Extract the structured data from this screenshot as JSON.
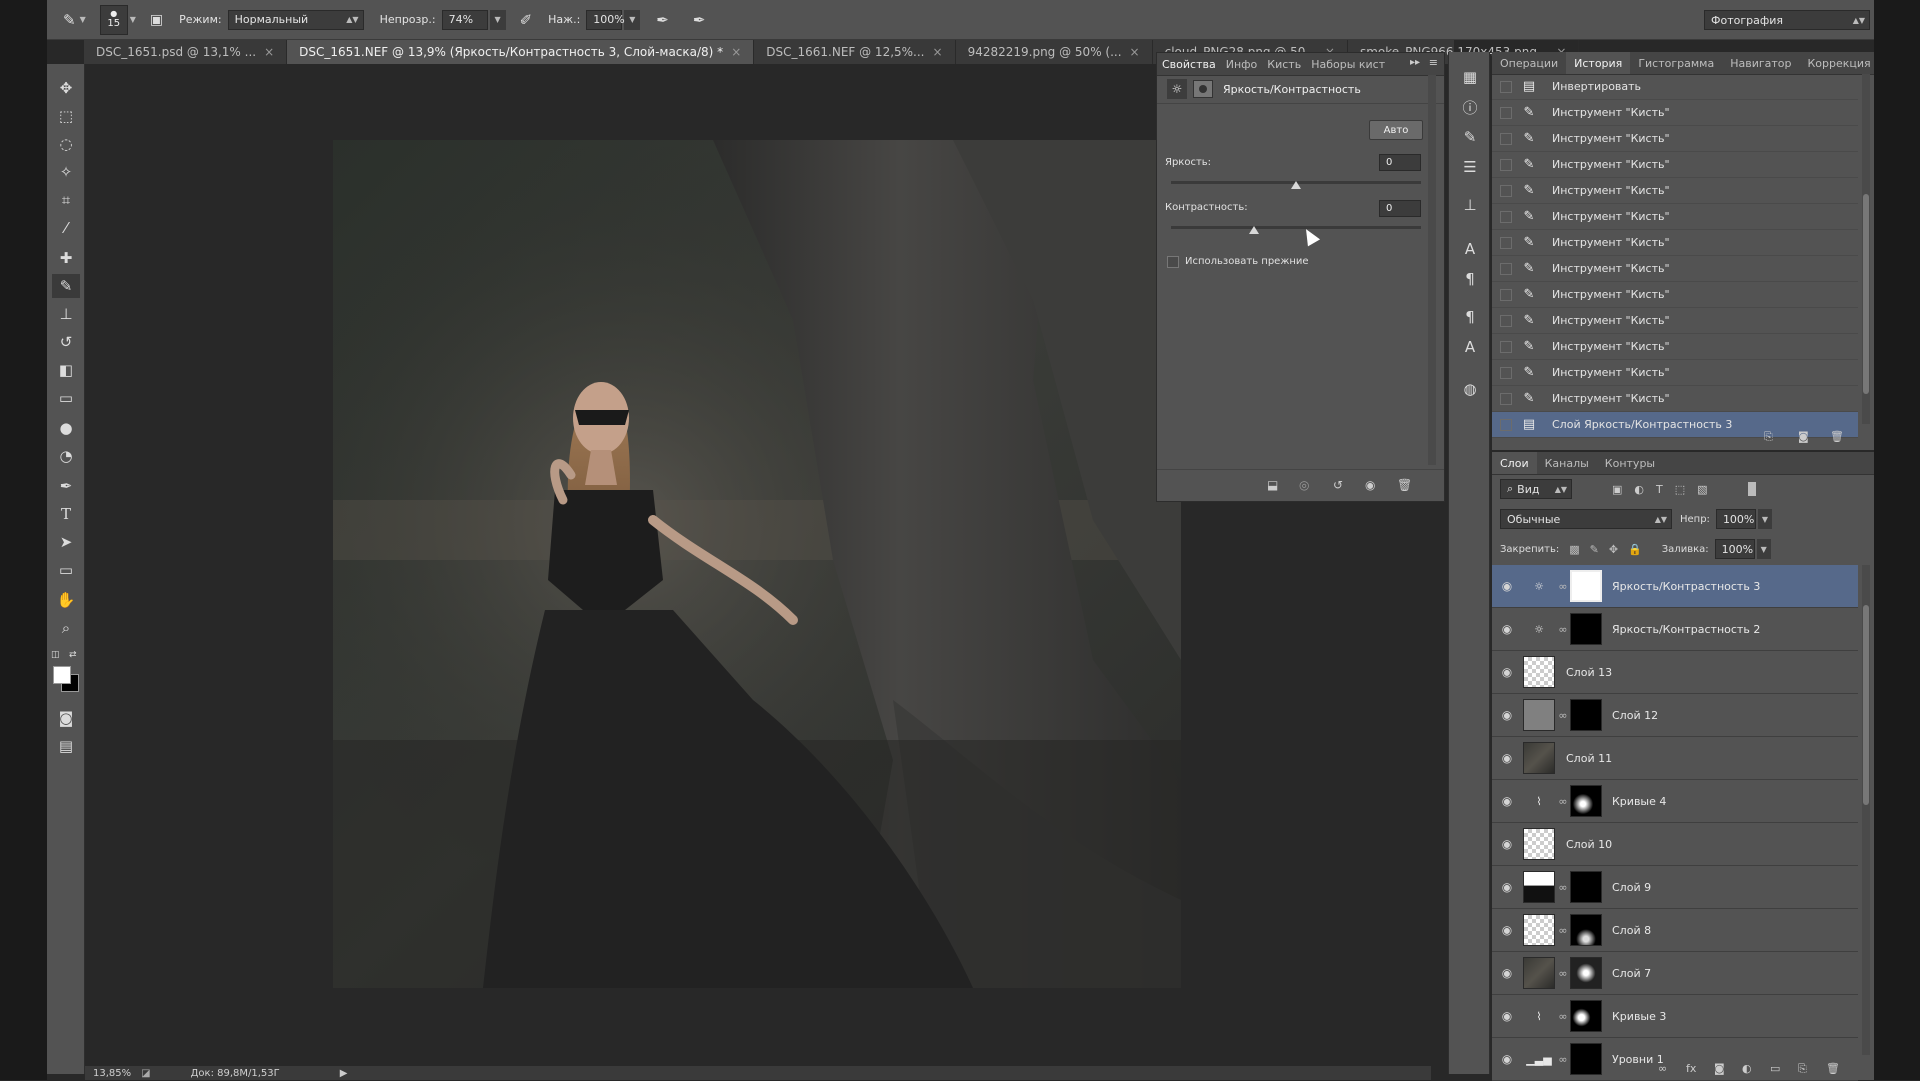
{
  "options": {
    "brush_size": "15",
    "mode_label": "Режим:",
    "mode_value": "Нормальный",
    "opacity_label": "Непрозр.:",
    "opacity_value": "74%",
    "pressure_label": "Наж.:",
    "pressure_value": "100%",
    "workspace": "Фотография"
  },
  "tabs": [
    {
      "label": "DSC_1651.psd @ 13,1% ..."
    },
    {
      "label": "DSC_1651.NEF @ 13,9% (Яркость/Контрастность 3, Слой-маска/8) *"
    },
    {
      "label": "DSC_1661.NEF @ 12,5%..."
    },
    {
      "label": "94282219.png @ 50% (..."
    },
    {
      "label": "cloud_PNG28.png @ 50..."
    },
    {
      "label": "smoke_PNG966.170x453.png..."
    }
  ],
  "properties": {
    "tabs": [
      "Свойства",
      "Инфо",
      "Кисть",
      "Наборы кист"
    ],
    "title": "Яркость/Контрастность",
    "auto": "Авто",
    "brightness_label": "Яркость:",
    "brightness_value": "0",
    "brightness_level": 0,
    "contrast_label": "Контрастность:",
    "contrast_value": "0",
    "contrast_level": 0,
    "legacy": "Использовать прежние"
  },
  "history": {
    "tabs": [
      "Операции",
      "История",
      "Гистограмма",
      "Навигатор",
      "Коррекция"
    ],
    "items": [
      "Инвертировать",
      "Инструмент \"Кисть\"",
      "Инструмент \"Кисть\"",
      "Инструмент \"Кисть\"",
      "Инструмент \"Кисть\"",
      "Инструмент \"Кисть\"",
      "Инструмент \"Кисть\"",
      "Инструмент \"Кисть\"",
      "Инструмент \"Кисть\"",
      "Инструмент \"Кисть\"",
      "Инструмент \"Кисть\"",
      "Инструмент \"Кисть\"",
      "Инструмент \"Кисть\"",
      "Слой Яркость/Контрастность 3"
    ]
  },
  "layers_panel": {
    "tabs": [
      "Слои",
      "Каналы",
      "Контуры"
    ],
    "filter": "Вид",
    "blend": "Обычные",
    "opacity_label": "Непр:",
    "opacity_value": "100%",
    "lock_label": "Закрепить:",
    "fill_label": "Заливка:",
    "fill_value": "100%",
    "layers": [
      "Яркость/Контрастность 3",
      "Яркость/Контрастность 2",
      "Слой 13",
      "Слой 12",
      "Слой 11",
      "Кривые 4",
      "Слой 10",
      "Слой 9",
      "Слой 8",
      "Слой 7",
      "Кривые 3",
      "Уровни 1"
    ]
  },
  "status": {
    "zoom": "13,85%",
    "doc": "Док: 89,8M/1,53Г"
  }
}
